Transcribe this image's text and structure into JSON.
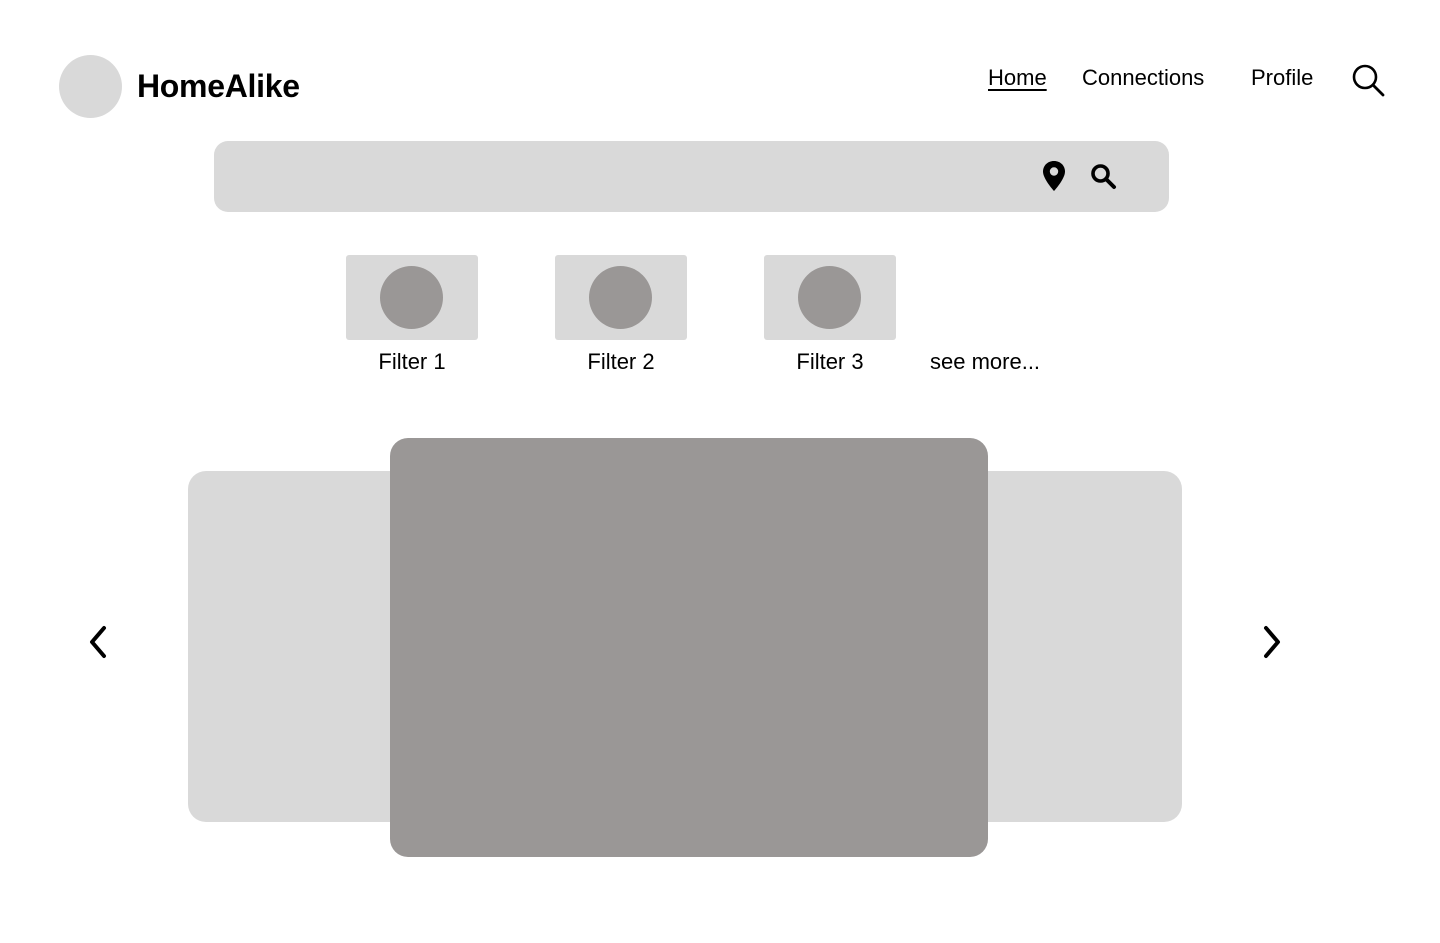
{
  "header": {
    "brand": "HomeAlike",
    "nav": [
      {
        "label": "Home",
        "active": true
      },
      {
        "label": "Connections",
        "active": false
      },
      {
        "label": "Profile",
        "active": false
      }
    ],
    "search_icon": "search-icon"
  },
  "search": {
    "value": "",
    "placeholder": "",
    "location_icon": "map-pin-icon",
    "search_icon": "search-icon"
  },
  "filters": {
    "items": [
      {
        "label": "Filter 1"
      },
      {
        "label": "Filter 2"
      },
      {
        "label": "Filter 3"
      }
    ],
    "see_more_label": "see more..."
  },
  "carousel": {
    "prev_icon": "chevron-left-icon",
    "next_icon": "chevron-right-icon"
  },
  "colors": {
    "placeholder_light": "#d9d9d9",
    "placeholder_dark": "#9a9796",
    "text": "#000000",
    "background": "#ffffff"
  }
}
